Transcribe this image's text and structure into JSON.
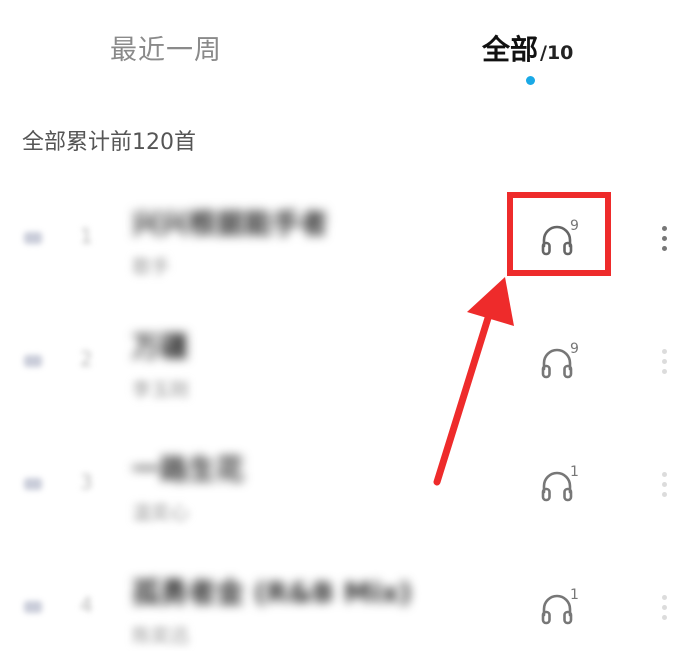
{
  "tabs": {
    "recent_label": "最近一周",
    "all_label": "全部",
    "all_count": "/10"
  },
  "summary": "全部累计前120首",
  "songs": [
    {
      "rank": "1",
      "title": "兴兴根据能手者",
      "artist": "歌手",
      "plays": "9"
    },
    {
      "rank": "2",
      "title": "万疆",
      "artist": "李玉刚",
      "plays": "9"
    },
    {
      "rank": "3",
      "title": "一路生花",
      "artist": "温奕心",
      "plays": "1"
    },
    {
      "rank": "4",
      "title": "孤勇者金 (R&B Mix)",
      "artist": "陈奕迅",
      "plays": "1"
    }
  ],
  "colors": {
    "accent_dot": "#1aa9e6",
    "annotation_red": "#ee2b2b"
  },
  "icons": {
    "play_count": "headphone-icon",
    "more": "more-vertical-icon"
  }
}
